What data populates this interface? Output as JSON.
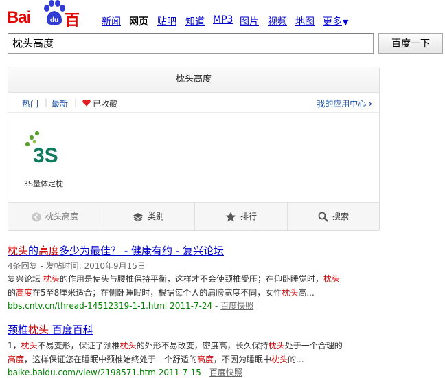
{
  "logo": {
    "bai": "Bai",
    "du": "du",
    "cn": "百度"
  },
  "nav": [
    {
      "label": "新闻",
      "active": false
    },
    {
      "label": "网页",
      "active": true
    },
    {
      "label": "贴吧",
      "active": false
    },
    {
      "label": "知道",
      "active": false
    },
    {
      "label": "MP3",
      "active": false
    },
    {
      "label": "图片",
      "active": false
    },
    {
      "label": "视频",
      "active": false
    },
    {
      "label": "地图",
      "active": false
    },
    {
      "label": "更多",
      "active": false
    }
  ],
  "search": {
    "value": "枕头高度",
    "button": "百度一下"
  },
  "card": {
    "title": "枕头高度",
    "tabs": {
      "hot": "热门",
      "new": "最新",
      "fav": "已收藏",
      "my_apps": "我的应用中心"
    },
    "app": {
      "name": "3S量体定枕",
      "logo_text": "3S"
    },
    "bar": {
      "pillow": "枕头高度",
      "category": "类别",
      "rank": "排行",
      "search": "搜索"
    }
  },
  "results": [
    {
      "title_parts": [
        "枕头",
        "的",
        "高度",
        "多少为最佳？ - 健康有约 - 复兴论坛"
      ],
      "meta": "4条回复 - 发帖时间: 2010年9月15日",
      "desc_line1": [
        "复兴论坛 ",
        "枕头",
        "的作用是使头与腰椎保持平衡，这样才不会使颈椎受压；在仰卧睡觉时，",
        "枕头"
      ],
      "desc_line2": [
        "的",
        "高度",
        "在5至8厘米适合；在侧卧睡眠时，根据每个人的肩膀宽度不同，女性",
        "枕头",
        "高..."
      ],
      "url": "bbs.cntv.cn/thread-14512319-1-1.html 2011-7-24",
      "snapshot": "百度快照"
    },
    {
      "title_parts": [
        "颈椎",
        "枕头",
        " 百度百科"
      ],
      "desc_line1": [
        "1，",
        "枕头",
        "不易变形，保证了颈椎",
        "枕头",
        "的外形不易改变，密度高，长久保持",
        "枕头",
        "处于一个合理的"
      ],
      "desc_line2": [
        "高度",
        "，这样保证您在睡眠中颈椎始终处于一个舒适的",
        "高度",
        "，不因为睡眠中",
        "枕头",
        "的..."
      ],
      "url": "baike.baidu.com/view/2198571.htm 2011-7-15",
      "snapshot": "百度快照"
    }
  ],
  "colors": {
    "brand_red": "#e10602",
    "paw_blue": "#2f3bd1",
    "link_blue": "#0000cc",
    "url_green": "#008000",
    "highlight_red": "#cc0000"
  }
}
